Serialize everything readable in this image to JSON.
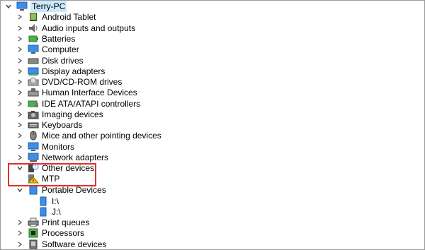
{
  "tree": {
    "root": "Terry-PC",
    "categories": [
      {
        "label": "Android Tablet",
        "icon": "android-tablet-icon",
        "expanded": false
      },
      {
        "label": "Audio inputs and outputs",
        "icon": "speaker-icon",
        "expanded": false
      },
      {
        "label": "Batteries",
        "icon": "battery-icon",
        "expanded": false
      },
      {
        "label": "Computer",
        "icon": "computer-monitor-icon",
        "expanded": false
      },
      {
        "label": "Disk drives",
        "icon": "disk-drive-icon",
        "expanded": false
      },
      {
        "label": "Display adapters",
        "icon": "display-adapter-icon",
        "expanded": false
      },
      {
        "label": "DVD/CD-ROM drives",
        "icon": "optical-drive-icon",
        "expanded": false
      },
      {
        "label": "Human Interface Devices",
        "icon": "hid-icon",
        "expanded": false
      },
      {
        "label": "IDE ATA/ATAPI controllers",
        "icon": "ide-controller-icon",
        "expanded": false
      },
      {
        "label": "Imaging devices",
        "icon": "camera-icon",
        "expanded": false
      },
      {
        "label": "Keyboards",
        "icon": "keyboard-icon",
        "expanded": false
      },
      {
        "label": "Mice and other pointing devices",
        "icon": "mouse-icon",
        "expanded": false
      },
      {
        "label": "Monitors",
        "icon": "monitor-icon",
        "expanded": false
      },
      {
        "label": "Network adapters",
        "icon": "network-adapter-icon",
        "expanded": false
      },
      {
        "label": "Other devices",
        "icon": "unknown-device-icon",
        "expanded": true,
        "children": [
          {
            "label": "MTP",
            "icon": "warning-device-icon"
          }
        ]
      },
      {
        "label": "Portable Devices",
        "icon": "portable-device-icon",
        "expanded": true,
        "children": [
          {
            "label": "I:\\",
            "icon": "drive-icon"
          },
          {
            "label": "J:\\",
            "icon": "drive-icon"
          }
        ]
      },
      {
        "label": "Print queues",
        "icon": "printer-icon",
        "expanded": false
      },
      {
        "label": "Processors",
        "icon": "processor-icon",
        "expanded": false
      },
      {
        "label": "Software devices",
        "icon": "software-device-icon",
        "expanded": false
      }
    ]
  },
  "colors": {
    "selection": "#cce8ff",
    "highlight_box": "#e0312a",
    "icon_blue": "#3c8ee8"
  }
}
